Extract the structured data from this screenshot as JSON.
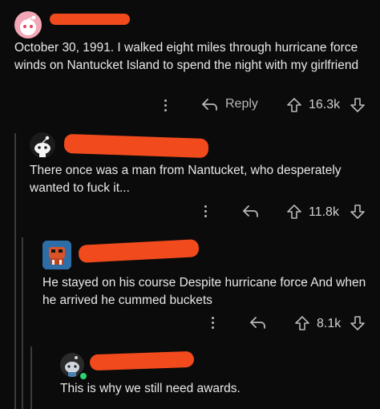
{
  "comments": [
    {
      "text": "October 30, 1991. I walked eight miles through hurricane force winds on Nantucket Island to spend the night with my girlfriend",
      "reply_label": "Reply",
      "score": "16.3k"
    },
    {
      "text": "There once was a man from Nantucket, who desperately wanted to fuck it...",
      "score": "11.8k"
    },
    {
      "text": "He stayed on his course Despite hurricane force And when he arrived he cummed buckets",
      "score": "8.1k"
    },
    {
      "text": "This is why we still need awards."
    }
  ],
  "colors": {
    "background": "#0b0b0b",
    "redaction": "#f14a1c",
    "online": "#2bd36f"
  }
}
